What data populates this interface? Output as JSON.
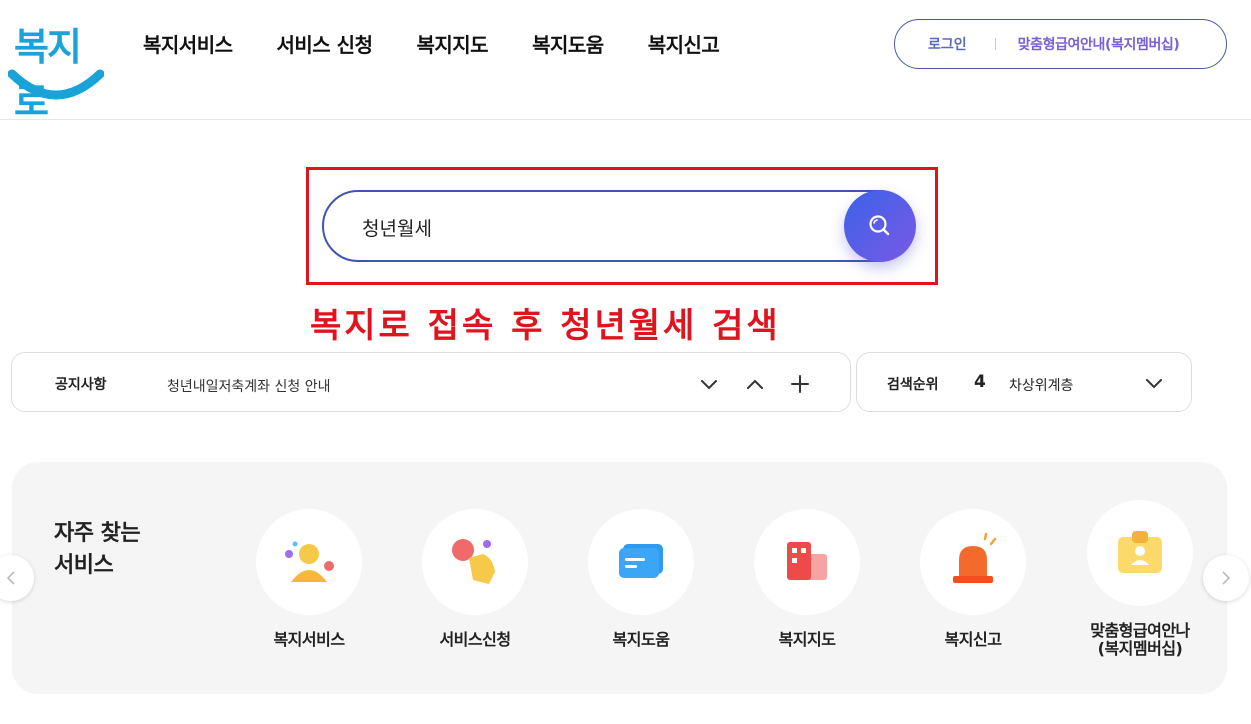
{
  "header": {
    "logo_text": "복지로",
    "nav": [
      "복지서비스",
      "서비스 신청",
      "복지지도",
      "복지도움",
      "복지신고"
    ],
    "login_label": "로그인",
    "member_label": "맞춤형급여안내(복지멤버십)"
  },
  "search": {
    "value": "청년월세",
    "caption": "복지로 접속 후 청년월세 검색"
  },
  "notice": {
    "label": "공지사항",
    "text": "청년내일저축계좌 신청 안내"
  },
  "rank": {
    "label": "검색순위",
    "number": "4",
    "keyword": "차상위계층"
  },
  "services": {
    "title_line1": "자주 찾는",
    "title_line2": "서비스",
    "items": [
      {
        "name": "복지서비스",
        "icon": "person-icon"
      },
      {
        "name": "서비스신청",
        "icon": "hand-tap-icon"
      },
      {
        "name": "복지도움",
        "icon": "chat-icon"
      },
      {
        "name": "복지지도",
        "icon": "building-icon"
      },
      {
        "name": "복지신고",
        "icon": "siren-icon"
      },
      {
        "name": "맞춤형급여안나\n(복지멤버십)",
        "icon": "id-badge-icon"
      }
    ]
  },
  "colors": {
    "accent": "#3f55b0",
    "highlight": "#e0141e",
    "search_button": "#5b5fe6"
  }
}
